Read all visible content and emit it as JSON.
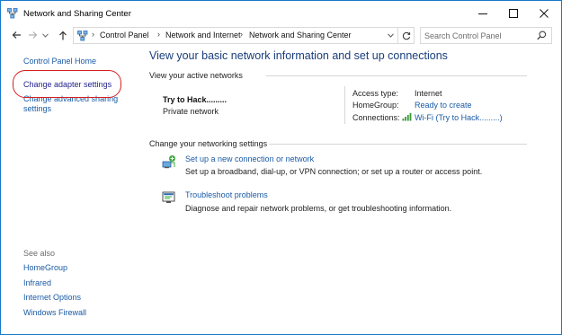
{
  "window": {
    "title": "Network and Sharing Center"
  },
  "address": {
    "crumbs": [
      "Control Panel",
      "Network and Internet",
      "Network and Sharing Center"
    ],
    "search_placeholder": "Search Control Panel"
  },
  "sidebar": {
    "home": "Control Panel Home",
    "change_adapter": "Change adapter settings",
    "change_sharing": "Change advanced sharing settings",
    "see_also_label": "See also",
    "see_also": [
      "HomeGroup",
      "Infrared",
      "Internet Options",
      "Windows Firewall"
    ]
  },
  "main": {
    "title": "View your basic network information and set up connections",
    "active_networks_label": "View your active networks",
    "network": {
      "name": "Try to Hack.........",
      "type": "Private network",
      "access_type_label": "Access type:",
      "access_type_value": "Internet",
      "homegroup_label": "HomeGroup:",
      "homegroup_value": "Ready to create",
      "connections_label": "Connections:",
      "connections_value": "Wi-Fi (Try to Hack.........)"
    },
    "change_settings_label": "Change your networking settings",
    "tasks": [
      {
        "link": "Set up a new connection or network",
        "desc": "Set up a broadband, dial-up, or VPN connection; or set up a router or access point.",
        "icon": "network-setup-icon"
      },
      {
        "link": "Troubleshoot problems",
        "desc": "Diagnose and repair network problems, or get troubleshooting information.",
        "icon": "troubleshoot-icon"
      }
    ]
  },
  "colors": {
    "link": "#1a5aa5",
    "title": "#1a3e7a",
    "highlight": "#d42020",
    "window_border": "#1979ca"
  }
}
